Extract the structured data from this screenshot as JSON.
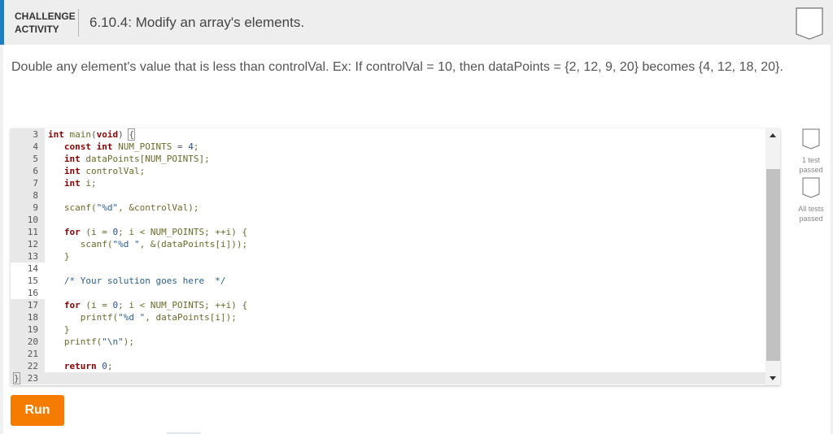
{
  "header": {
    "activity_type_line1": "CHALLENGE",
    "activity_type_line2": "ACTIVITY",
    "title": "6.10.4: Modify an array's elements.",
    "accent_color": "#1a7fc4",
    "completion_icon": "empty-badge-icon"
  },
  "instructions": "Double any element's value that is less than controlVal. Ex: If controlVal = 10, then dataPoints = {2, 12, 9, 20} becomes {4, 12, 18, 20}.",
  "editor": {
    "lines": [
      {
        "n": "3",
        "readonly": true
      },
      {
        "n": "4",
        "readonly": true
      },
      {
        "n": "5",
        "readonly": true
      },
      {
        "n": "6",
        "readonly": true
      },
      {
        "n": "7",
        "readonly": true
      },
      {
        "n": "8",
        "readonly": true
      },
      {
        "n": "9",
        "readonly": true
      },
      {
        "n": "10",
        "readonly": true
      },
      {
        "n": "11",
        "readonly": true
      },
      {
        "n": "12",
        "readonly": true
      },
      {
        "n": "13",
        "readonly": true
      },
      {
        "n": "14",
        "readonly": false
      },
      {
        "n": "15",
        "readonly": false
      },
      {
        "n": "16",
        "readonly": false
      },
      {
        "n": "17",
        "readonly": true
      },
      {
        "n": "18",
        "readonly": true
      },
      {
        "n": "19",
        "readonly": true
      },
      {
        "n": "20",
        "readonly": true
      },
      {
        "n": "21",
        "readonly": true
      },
      {
        "n": "22",
        "readonly": true
      },
      {
        "n": "23",
        "readonly": true
      }
    ],
    "code": {
      "l3": {
        "kw1": "int",
        "fn": "main",
        "p1": "(",
        "kw2": "void",
        "p2": ") ",
        "brace": "{"
      },
      "l4": {
        "indent": "   ",
        "kw1": "const",
        "kw2": "int",
        "id": "NUM_POINTS",
        "op": " = ",
        "num": "4",
        "end": ";"
      },
      "l5": {
        "indent": "   ",
        "kw": "int",
        "id": "dataPoints[NUM_POINTS]",
        "end": ";"
      },
      "l6": {
        "indent": "   ",
        "kw": "int",
        "id": "controlVal",
        "end": ";"
      },
      "l7": {
        "indent": "   ",
        "kw": "int",
        "id": "i",
        "end": ";"
      },
      "l9": {
        "indent": "   ",
        "fn": "scanf(",
        "str": "\"%d\"",
        "rest": ", &controlVal);"
      },
      "l11": {
        "indent": "   ",
        "kw": "for",
        "p": " (i = ",
        "num": "0",
        "rest": "; i < NUM_POINTS; ++i) {"
      },
      "l12": {
        "indent": "      ",
        "fn": "scanf(",
        "str": "\"%d \"",
        "rest": ", &(dataPoints[i]));"
      },
      "l13": {
        "indent": "   ",
        "text": "}"
      },
      "l15": {
        "indent": "   ",
        "comment": "/* Your solution goes here  */"
      },
      "l17": {
        "indent": "   ",
        "kw": "for",
        "p": " (i = ",
        "num": "0",
        "rest": "; i < NUM_POINTS; ++i) {"
      },
      "l18": {
        "indent": "      ",
        "fn": "printf(",
        "str": "\"%d \"",
        "rest": ", dataPoints[i]);"
      },
      "l19": {
        "indent": "   ",
        "text": "}"
      },
      "l20": {
        "indent": "   ",
        "fn": "printf(",
        "str": "\"\\n\"",
        "rest": ");"
      },
      "l22": {
        "indent": "   ",
        "kw": "return",
        "sp": " ",
        "num": "0",
        "end": ";"
      },
      "l23": {
        "text": "}"
      }
    }
  },
  "tests": [
    {
      "label": "1 test passed",
      "icon": "test-badge-icon"
    },
    {
      "label": "All tests passed",
      "icon": "test-badge-icon"
    }
  ],
  "run_button": {
    "label": "Run",
    "color": "#f57c00"
  }
}
